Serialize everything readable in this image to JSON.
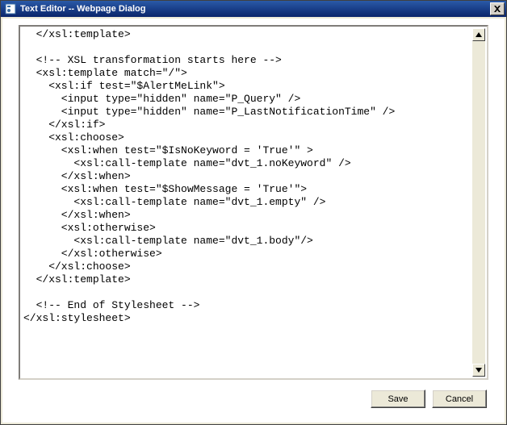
{
  "window": {
    "title": "Text Editor -- Webpage Dialog"
  },
  "editor": {
    "content": "  </xsl:template>\n\n  <!-- XSL transformation starts here -->\n  <xsl:template match=\"/\">\n    <xsl:if test=\"$AlertMeLink\">\n      <input type=\"hidden\" name=\"P_Query\" />\n      <input type=\"hidden\" name=\"P_LastNotificationTime\" />\n    </xsl:if>\n    <xsl:choose>\n      <xsl:when test=\"$IsNoKeyword = 'True'\" >\n        <xsl:call-template name=\"dvt_1.noKeyword\" />\n      </xsl:when>\n      <xsl:when test=\"$ShowMessage = 'True'\">\n        <xsl:call-template name=\"dvt_1.empty\" />\n      </xsl:when>\n      <xsl:otherwise>\n        <xsl:call-template name=\"dvt_1.body\"/>\n      </xsl:otherwise>\n    </xsl:choose>\n  </xsl:template>\n\n  <!-- End of Stylesheet -->\n</xsl:stylesheet>"
  },
  "buttons": {
    "save": "Save",
    "cancel": "Cancel"
  },
  "scroll": {
    "up": "▲",
    "down": "▼"
  },
  "close": {
    "glyph": "✕"
  }
}
